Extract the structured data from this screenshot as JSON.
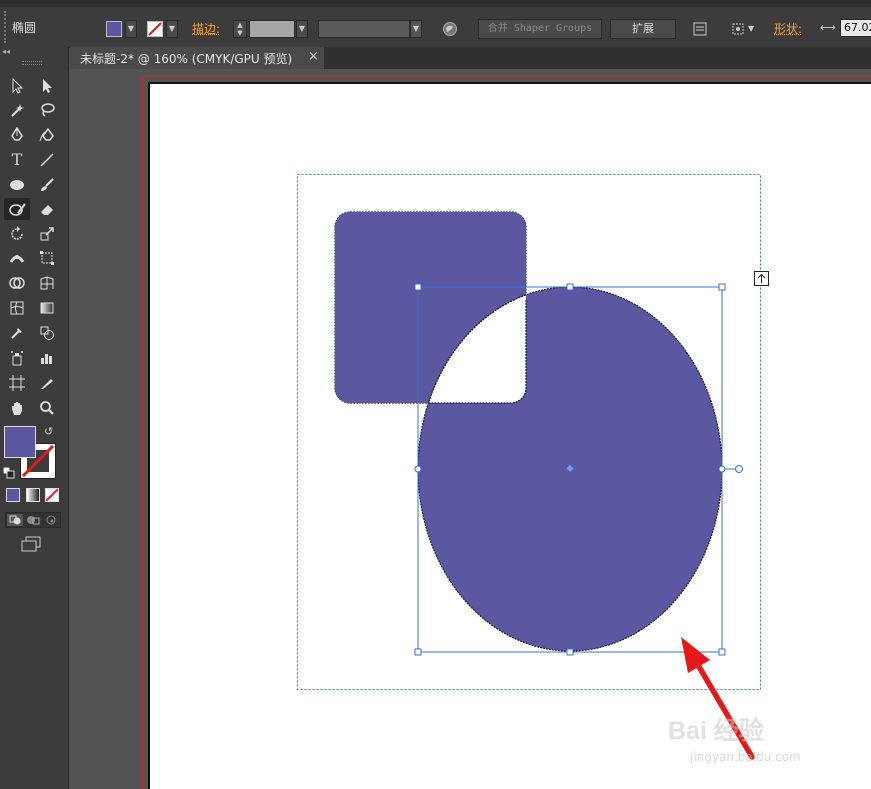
{
  "app": {
    "tool_name": "椭圆",
    "document_tab": "未标题-2* @ 160% (CMYK/GPU 预览)",
    "tab_close": "×"
  },
  "control_bar": {
    "stroke_label": "描边:",
    "merge_label": "合并",
    "shaper_groups_label": "Shaper Groups",
    "expand_label": "扩展",
    "shape_label": "形状:",
    "width_value": "67.02"
  },
  "colors": {
    "fill_color": "#5b57a1",
    "teal_shape": "#38b7a0",
    "selection_blue": "#3b6fd6",
    "arrow_red": "#e8181a",
    "artboard_edge": "#c8262a"
  },
  "icons": {
    "swap_icon": "↺",
    "watermark_top": "Bai 经验",
    "watermark_bottom": "jingyan.baidu.com"
  }
}
